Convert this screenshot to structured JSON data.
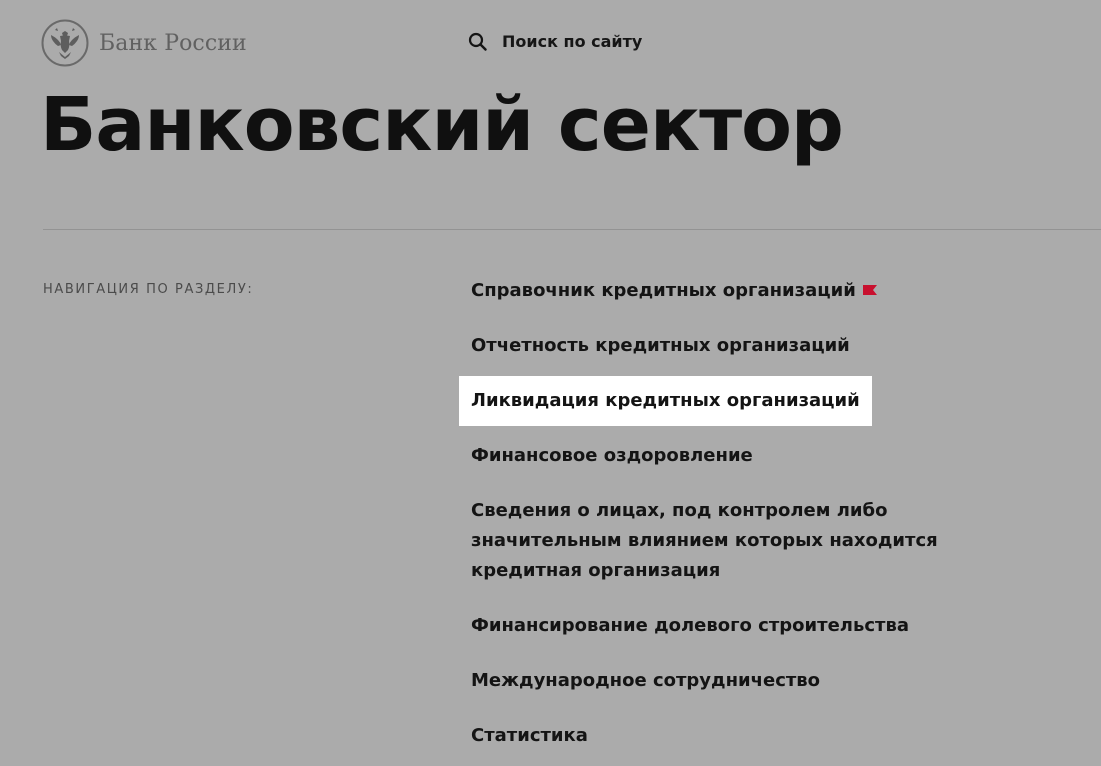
{
  "header": {
    "logo_text": "Банк России",
    "search_label": "Поиск по сайту"
  },
  "page": {
    "title": "Банковский сектор"
  },
  "navigation": {
    "heading": "Навигация по разделу:",
    "items": [
      {
        "label": "Справочник кредитных организаций",
        "badge": "flag-icon",
        "active": false
      },
      {
        "label": "Отчетность кредитных организаций",
        "active": false
      },
      {
        "label": "Ликвидация кредитных организаций",
        "active": true
      },
      {
        "label": "Финансовое оздоровление",
        "active": false
      },
      {
        "label": "Сведения о лицах, под контролем либо значительным влиянием которых находится кредитная организация",
        "active": false
      },
      {
        "label": "Финансирование долевого строительства",
        "active": false
      },
      {
        "label": "Международное сотрудничество",
        "active": false
      },
      {
        "label": "Статистика",
        "active": false
      }
    ]
  },
  "colors": {
    "background": "#ababab",
    "active_item_background": "#ffffff",
    "flag_red": "#c8102e",
    "logo_gray": "#616161"
  }
}
